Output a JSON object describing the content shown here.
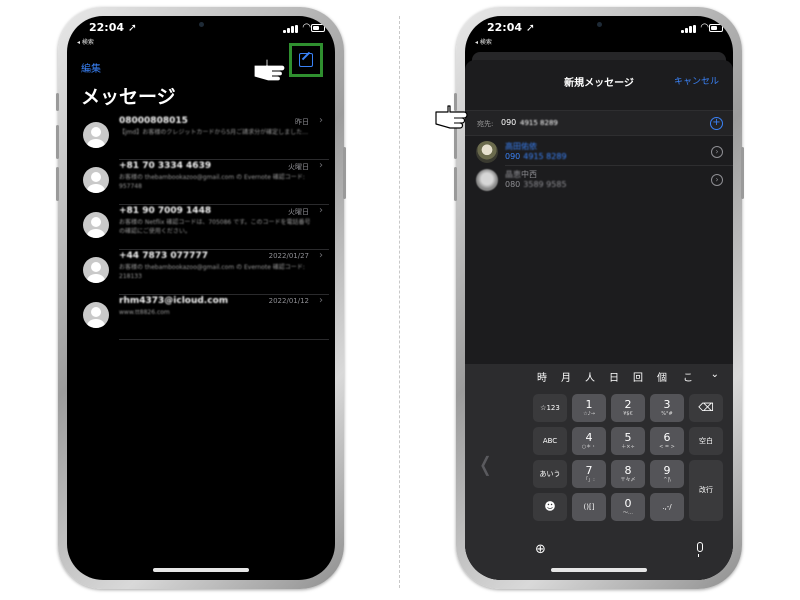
{
  "left_phone": {
    "status": {
      "time": "22:04 ➚",
      "back_app": "◂ 検索"
    },
    "edit": "編集",
    "title": "メッセージ",
    "conversations": [
      {
        "sender": "08000808015",
        "date": "昨日",
        "preview": "【jmd】お客様のクレジットカードから5月ご請求分が確定しました…"
      },
      {
        "sender": "+81 70 3334 4639",
        "date": "火曜日",
        "preview": "お客様の thebambookazoo@gmail.com の Evernote 確認コード: 957748"
      },
      {
        "sender": "+81 90 7009 1448",
        "date": "火曜日",
        "preview": "お客様の Netflix 確認コードは、705086 です。このコードを電話番号の確認にご使用ください。"
      },
      {
        "sender": "+44 7873 077777",
        "date": "2022/01/27",
        "preview": "お客様の thebambookazoo@gmail.com の Evernote 確認コード: 218133"
      },
      {
        "sender": "rhm4373@icloud.com",
        "date": "2022/01/12",
        "preview": "www.tt8826.com"
      }
    ]
  },
  "right_phone": {
    "status": {
      "time": "22:04 ➚",
      "back_app": "◂ 検索"
    },
    "sheet_title": "新規メッセージ",
    "cancel": "キャンセル",
    "to_label": "宛先:",
    "to_prefix": "090",
    "to_rest": "4915 8289",
    "contacts": [
      {
        "name": "高田佑依",
        "number_prefix": "090",
        "number_rest": "4915 8289"
      },
      {
        "name_blur": "晶恵",
        "name": "中西",
        "number_prefix": "080",
        "number_rest": "3589 9585"
      }
    ],
    "candidates": [
      "時",
      "月",
      "人",
      "日",
      "回",
      "個",
      "こ"
    ],
    "keys": {
      "k123": "☆123",
      "abc": "ABC",
      "aiu": "あいう",
      "emoji": "☻",
      "k1": {
        "main": "1",
        "sub": "☆♪→"
      },
      "k2": {
        "main": "2",
        "sub": "¥$€"
      },
      "k3": {
        "main": "3",
        "sub": "%°#"
      },
      "k4": {
        "main": "4",
        "sub": "○＊・"
      },
      "k5": {
        "main": "5",
        "sub": "＋×÷"
      },
      "k6": {
        "main": "6",
        "sub": "< = >"
      },
      "k7": {
        "main": "7",
        "sub": "「」:"
      },
      "k8": {
        "main": "8",
        "sub": "〒々〆"
      },
      "k9": {
        "main": "9",
        "sub": "^|\\"
      },
      "k0": {
        "main": "0",
        "sub": "〜…"
      },
      "paren": "()[]",
      "punct": ".,-/",
      "delete": "⌫",
      "space": "空白",
      "return": "改行"
    }
  }
}
